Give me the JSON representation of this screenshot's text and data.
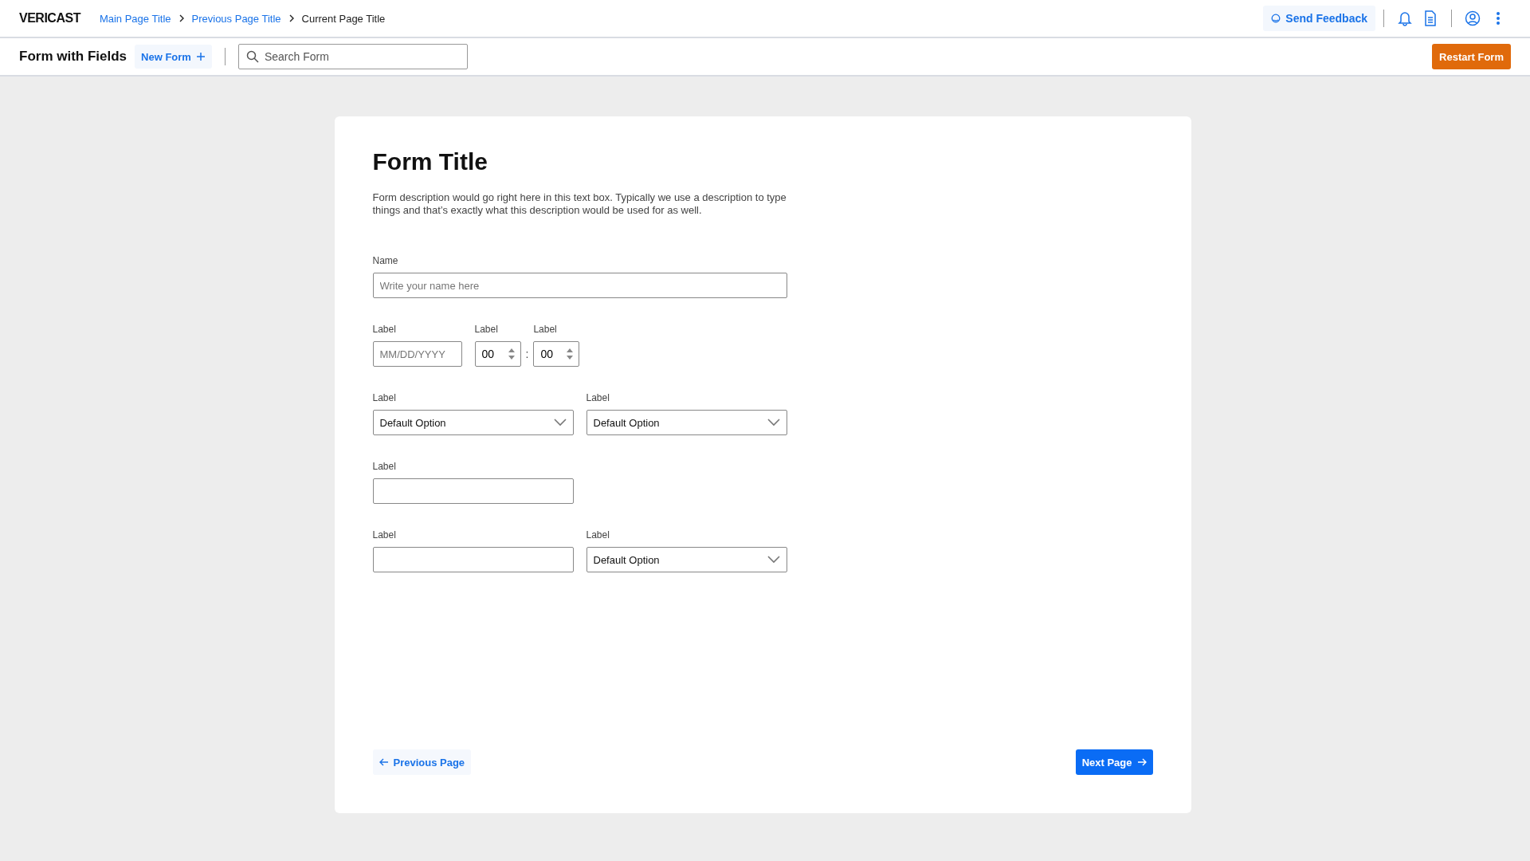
{
  "header": {
    "logo": "VERICAST",
    "breadcrumbs": [
      {
        "label": "Main Page Title",
        "kind": "link"
      },
      {
        "label": "Previous Page Title",
        "kind": "link"
      },
      {
        "label": "Current Page Title",
        "kind": "current"
      }
    ],
    "feedback": "Send Feedback"
  },
  "toolbar": {
    "title": "Form with Fields",
    "new_form": "New Form",
    "search": {
      "placeholder": "Search Form"
    },
    "restart": "Restart Form"
  },
  "form": {
    "title": "Form Title",
    "description": "Form description would go right here in this text box. Typically we use a description to type things and that’s exactly what this description would be used for as well.",
    "rows": [
      [
        {
          "kind": "text",
          "wide": true,
          "label": "Name",
          "placeholder": "Write your name here"
        }
      ],
      [
        {
          "kind": "date",
          "label": "Label",
          "placeholder": "MM/DD/YYYY"
        },
        {
          "kind": "time",
          "label": "Label",
          "value": "00"
        },
        {
          "kind": "separator",
          "text": ":"
        },
        {
          "kind": "time",
          "label": "Label",
          "value": "00"
        }
      ],
      [
        {
          "kind": "select",
          "label": "Label",
          "value": "Default Option"
        },
        {
          "kind": "select",
          "label": "Label",
          "value": "Default Option"
        }
      ],
      [
        {
          "kind": "text",
          "wide": false,
          "label": "Label"
        }
      ],
      [
        {
          "kind": "text",
          "wide": false,
          "label": "Label"
        },
        {
          "kind": "select",
          "label": "Label",
          "value": "Default Option"
        }
      ]
    ],
    "previous": "Previous Page",
    "next": "Next Page"
  }
}
